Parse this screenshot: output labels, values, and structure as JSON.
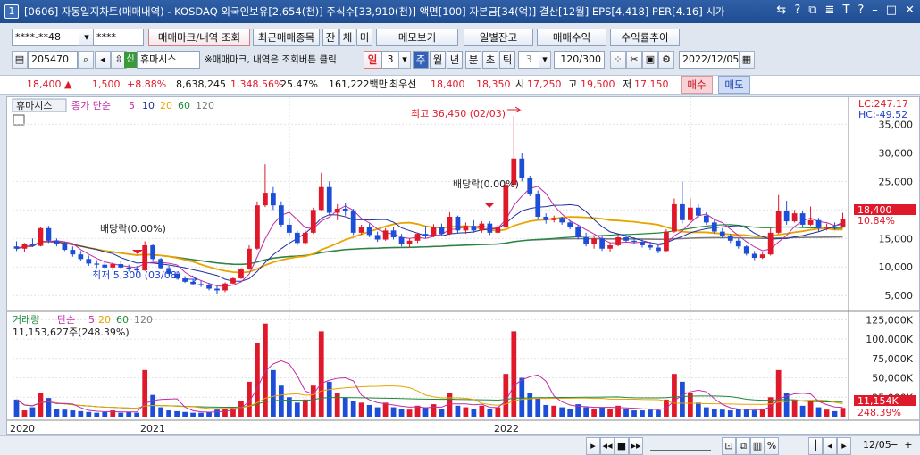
{
  "window": {
    "num": "1",
    "title": "[0606] 자동일지차트(매매내역) - KOSDAQ 외국인보유[2,654(천)] 주식수[33,910(천)] 액면[100] 자본금[34(억)] 결산[12월] EPS[4,418] PER[4.16] 시가",
    "buttons": [
      "⇆",
      "?",
      "⧉",
      "≣",
      "T",
      "?",
      "–",
      "□",
      "✕"
    ]
  },
  "toolbar1": {
    "account": "****-**48",
    "password": "****",
    "trade_mark_btn": "매매마크/내역 조회",
    "recent_items_btn": "최근매매종목",
    "tabs": [
      "잔",
      "체",
      "미"
    ],
    "memo_btn": "메모보기",
    "daily_balance_btn": "일별잔고",
    "trade_profit_btn": "매매수익",
    "return_trend_btn": "수익률추이"
  },
  "toolbar2": {
    "code": "205470",
    "badge": "신",
    "name": "휴마시스",
    "hint": "※매매마크, 내역은 조회버튼 클릭",
    "period_label": "일",
    "period_value": "3",
    "periods": [
      "주",
      "월",
      "년",
      "분",
      "초",
      "틱"
    ],
    "tick_value": "3",
    "count": "120/300",
    "date": "2022/12/05"
  },
  "quote": {
    "price": "18,400",
    "arrow": "▲",
    "change": "1,500",
    "rate": "+8.88%",
    "volume": "8,638,245",
    "vol_rate": "1,348.56%",
    "turnover": "25.47%",
    "amount": "161,222백만",
    "best_label": "최우선",
    "ask": "18,400",
    "bid": "18,350",
    "open_label": "시",
    "open": "17,250",
    "high_label": "고",
    "high": "19,500",
    "low_label": "저",
    "low": "17,150",
    "buy_btn": "매수",
    "sell_btn": "매도"
  },
  "price_panel": {
    "legend": {
      "name": "휴마시스",
      "ma_label": "종가 단순",
      "p5": "5",
      "p10": "10",
      "p20": "20",
      "p60": "60",
      "p120": "120"
    },
    "lc": "LC:247.17",
    "hc": "HC:-49.52",
    "yticks": [
      "35,000",
      "30,000",
      "25,000",
      "20,000",
      "15,000",
      "10,000",
      "5,000"
    ],
    "price_tag": "18,400",
    "pct_tag": "10.84%",
    "annotations": {
      "high": "최고 36,450 (02/03)",
      "low": "최저 5,300 (03/08)",
      "div1": "배당락(0.00%)",
      "div2": "배당락(0.00%)"
    }
  },
  "volume_panel": {
    "legend": {
      "name": "거래량",
      "ma_label": "단순",
      "p5": "5",
      "p20": "20",
      "p60": "60",
      "p120": "120"
    },
    "info": "11,153,627주(248.39%)",
    "yticks": [
      "125,000K",
      "100,000K",
      "75,000K",
      "50,000K",
      "25,000K"
    ],
    "vol_tag": "11,154K",
    "pct_tag": "248.39%"
  },
  "xaxis": {
    "labels": [
      "2020",
      "2021",
      "2022"
    ],
    "end_label": "12/05"
  },
  "colors": {
    "up": "#e0192a",
    "down": "#1d4ed8",
    "ma5": "#c02ca6",
    "ma10": "#1f2f9c",
    "ma20": "#e8a400",
    "ma60": "#1f8a3a",
    "ma120": "#7a7a7a"
  },
  "chart_data": {
    "type": "candlestick",
    "series": [
      {
        "o": 13600,
        "h": 14500,
        "l": 12800,
        "c": 13200
      },
      {
        "o": 13200,
        "h": 14200,
        "l": 12600,
        "c": 14000
      },
      {
        "o": 14000,
        "h": 15000,
        "l": 13500,
        "c": 13700
      },
      {
        "o": 13700,
        "h": 17000,
        "l": 13600,
        "c": 16800
      },
      {
        "o": 16800,
        "h": 17200,
        "l": 14200,
        "c": 14600
      },
      {
        "o": 14600,
        "h": 15000,
        "l": 13600,
        "c": 14000
      },
      {
        "o": 14000,
        "h": 14400,
        "l": 12800,
        "c": 13000
      },
      {
        "o": 13000,
        "h": 13600,
        "l": 11800,
        "c": 12200
      },
      {
        "o": 12200,
        "h": 12800,
        "l": 11000,
        "c": 11400
      },
      {
        "o": 11400,
        "h": 12000,
        "l": 10200,
        "c": 10600
      },
      {
        "o": 10600,
        "h": 11200,
        "l": 9800,
        "c": 10400
      },
      {
        "o": 10400,
        "h": 11000,
        "l": 9600,
        "c": 9900
      },
      {
        "o": 9900,
        "h": 10800,
        "l": 9400,
        "c": 10500
      },
      {
        "o": 10500,
        "h": 11000,
        "l": 9700,
        "c": 9900
      },
      {
        "o": 9900,
        "h": 10400,
        "l": 9200,
        "c": 9600
      },
      {
        "o": 9600,
        "h": 10200,
        "l": 9000,
        "c": 9400
      },
      {
        "o": 9400,
        "h": 14500,
        "l": 9300,
        "c": 13800
      },
      {
        "o": 13800,
        "h": 14000,
        "l": 11000,
        "c": 11400
      },
      {
        "o": 11400,
        "h": 11600,
        "l": 9600,
        "c": 9800
      },
      {
        "o": 9800,
        "h": 10200,
        "l": 8600,
        "c": 8800
      },
      {
        "o": 8800,
        "h": 9200,
        "l": 7800,
        "c": 8000
      },
      {
        "o": 8000,
        "h": 8400,
        "l": 7200,
        "c": 7400
      },
      {
        "o": 7400,
        "h": 7800,
        "l": 6800,
        "c": 7000
      },
      {
        "o": 7000,
        "h": 7600,
        "l": 6500,
        "c": 6900
      },
      {
        "o": 6900,
        "h": 7200,
        "l": 5900,
        "c": 6200
      },
      {
        "o": 6200,
        "h": 6600,
        "l": 5300,
        "c": 5900
      },
      {
        "o": 5900,
        "h": 7300,
        "l": 5600,
        "c": 7100
      },
      {
        "o": 7100,
        "h": 8200,
        "l": 7000,
        "c": 8000
      },
      {
        "o": 8000,
        "h": 9800,
        "l": 7900,
        "c": 9600
      },
      {
        "o": 9600,
        "h": 13800,
        "l": 9500,
        "c": 13200
      },
      {
        "o": 13200,
        "h": 21500,
        "l": 13000,
        "c": 20800
      },
      {
        "o": 20800,
        "h": 28000,
        "l": 20500,
        "c": 23000
      },
      {
        "o": 23000,
        "h": 24000,
        "l": 20000,
        "c": 20800
      },
      {
        "o": 20800,
        "h": 21500,
        "l": 17000,
        "c": 17400
      },
      {
        "o": 17400,
        "h": 18600,
        "l": 15500,
        "c": 16000
      },
      {
        "o": 16000,
        "h": 16400,
        "l": 13800,
        "c": 14200
      },
      {
        "o": 14200,
        "h": 16500,
        "l": 13800,
        "c": 16000
      },
      {
        "o": 16000,
        "h": 20400,
        "l": 15800,
        "c": 20000
      },
      {
        "o": 20000,
        "h": 26500,
        "l": 19800,
        "c": 24000
      },
      {
        "o": 24000,
        "h": 25000,
        "l": 19000,
        "c": 19500
      },
      {
        "o": 19500,
        "h": 21000,
        "l": 18200,
        "c": 20200
      },
      {
        "o": 20200,
        "h": 21200,
        "l": 19000,
        "c": 19800
      },
      {
        "o": 19800,
        "h": 20200,
        "l": 15600,
        "c": 16000
      },
      {
        "o": 16000,
        "h": 17400,
        "l": 15600,
        "c": 17000
      },
      {
        "o": 17000,
        "h": 17600,
        "l": 15200,
        "c": 15600
      },
      {
        "o": 15600,
        "h": 16200,
        "l": 14400,
        "c": 14800
      },
      {
        "o": 14800,
        "h": 16800,
        "l": 14600,
        "c": 16400
      },
      {
        "o": 16400,
        "h": 17000,
        "l": 14800,
        "c": 15200
      },
      {
        "o": 15200,
        "h": 15800,
        "l": 13600,
        "c": 14000
      },
      {
        "o": 14000,
        "h": 15000,
        "l": 13400,
        "c": 14600
      },
      {
        "o": 14600,
        "h": 16000,
        "l": 14200,
        "c": 15800
      },
      {
        "o": 15800,
        "h": 17200,
        "l": 15000,
        "c": 15400
      },
      {
        "o": 15400,
        "h": 17500,
        "l": 15200,
        "c": 17000
      },
      {
        "o": 17000,
        "h": 17600,
        "l": 15400,
        "c": 15800
      },
      {
        "o": 15800,
        "h": 19600,
        "l": 15600,
        "c": 18800
      },
      {
        "o": 18800,
        "h": 19000,
        "l": 16000,
        "c": 16400
      },
      {
        "o": 16400,
        "h": 17800,
        "l": 15800,
        "c": 17200
      },
      {
        "o": 17200,
        "h": 18200,
        "l": 16000,
        "c": 16400
      },
      {
        "o": 16400,
        "h": 18000,
        "l": 16000,
        "c": 17600
      },
      {
        "o": 17600,
        "h": 18000,
        "l": 15600,
        "c": 16000
      },
      {
        "o": 16000,
        "h": 17400,
        "l": 15800,
        "c": 17000
      },
      {
        "o": 17000,
        "h": 25000,
        "l": 16800,
        "c": 24400
      },
      {
        "o": 24400,
        "h": 36450,
        "l": 24000,
        "c": 29000
      },
      {
        "o": 29000,
        "h": 30000,
        "l": 25000,
        "c": 25600
      },
      {
        "o": 25600,
        "h": 26000,
        "l": 22400,
        "c": 22800
      },
      {
        "o": 22800,
        "h": 23400,
        "l": 18400,
        "c": 18800
      },
      {
        "o": 18800,
        "h": 19400,
        "l": 17600,
        "c": 18200
      },
      {
        "o": 18200,
        "h": 19000,
        "l": 17800,
        "c": 18600
      },
      {
        "o": 18600,
        "h": 18800,
        "l": 17400,
        "c": 17800
      },
      {
        "o": 17800,
        "h": 18200,
        "l": 16600,
        "c": 17000
      },
      {
        "o": 17000,
        "h": 17400,
        "l": 14800,
        "c": 15200
      },
      {
        "o": 15200,
        "h": 16000,
        "l": 13600,
        "c": 14000
      },
      {
        "o": 14000,
        "h": 15400,
        "l": 13200,
        "c": 15000
      },
      {
        "o": 15000,
        "h": 15400,
        "l": 12800,
        "c": 13200
      },
      {
        "o": 13200,
        "h": 14200,
        "l": 12600,
        "c": 13800
      },
      {
        "o": 13800,
        "h": 15600,
        "l": 13600,
        "c": 15200
      },
      {
        "o": 15200,
        "h": 15600,
        "l": 14400,
        "c": 14600
      },
      {
        "o": 14600,
        "h": 15200,
        "l": 14000,
        "c": 14400
      },
      {
        "o": 14400,
        "h": 14800,
        "l": 13400,
        "c": 13800
      },
      {
        "o": 13800,
        "h": 14400,
        "l": 13000,
        "c": 13400
      },
      {
        "o": 13400,
        "h": 14000,
        "l": 12400,
        "c": 12800
      },
      {
        "o": 12800,
        "h": 16600,
        "l": 12700,
        "c": 16200
      },
      {
        "o": 16200,
        "h": 22000,
        "l": 16000,
        "c": 21000
      },
      {
        "o": 21000,
        "h": 25000,
        "l": 17600,
        "c": 18200
      },
      {
        "o": 18200,
        "h": 22000,
        "l": 18000,
        "c": 20400
      },
      {
        "o": 20400,
        "h": 21000,
        "l": 18600,
        "c": 19000
      },
      {
        "o": 19000,
        "h": 19600,
        "l": 17400,
        "c": 17800
      },
      {
        "o": 17800,
        "h": 18400,
        "l": 15800,
        "c": 16200
      },
      {
        "o": 16200,
        "h": 16800,
        "l": 15000,
        "c": 15400
      },
      {
        "o": 15400,
        "h": 15800,
        "l": 14200,
        "c": 14600
      },
      {
        "o": 14600,
        "h": 15000,
        "l": 13200,
        "c": 13600
      },
      {
        "o": 13600,
        "h": 13800,
        "l": 12000,
        "c": 12300
      },
      {
        "o": 12300,
        "h": 12800,
        "l": 11200,
        "c": 11600
      },
      {
        "o": 11600,
        "h": 12600,
        "l": 11400,
        "c": 12200
      },
      {
        "o": 12200,
        "h": 16800,
        "l": 12000,
        "c": 16000
      },
      {
        "o": 16000,
        "h": 22600,
        "l": 15800,
        "c": 19800
      },
      {
        "o": 19800,
        "h": 21600,
        "l": 17400,
        "c": 18000
      },
      {
        "o": 18000,
        "h": 20000,
        "l": 17800,
        "c": 19400
      },
      {
        "o": 19400,
        "h": 19800,
        "l": 17000,
        "c": 17400
      },
      {
        "o": 17400,
        "h": 20600,
        "l": 17200,
        "c": 18200
      },
      {
        "o": 18200,
        "h": 18600,
        "l": 16200,
        "c": 16800
      },
      {
        "o": 16800,
        "h": 17600,
        "l": 16400,
        "c": 17000
      },
      {
        "o": 17000,
        "h": 17800,
        "l": 16500,
        "c": 16900
      },
      {
        "o": 16900,
        "h": 19500,
        "l": 17150,
        "c": 18400
      }
    ],
    "volume_K": [
      22000,
      8000,
      12000,
      30000,
      24000,
      10000,
      9000,
      8000,
      7000,
      6000,
      5000,
      6000,
      8000,
      5000,
      6000,
      5000,
      60000,
      28000,
      12000,
      8000,
      7000,
      6000,
      5000,
      5000,
      6000,
      9000,
      10000,
      12000,
      20000,
      45000,
      95000,
      120000,
      60000,
      40000,
      25000,
      18000,
      22000,
      40000,
      110000,
      45000,
      30000,
      25000,
      20000,
      18000,
      15000,
      12000,
      18000,
      12000,
      10000,
      9000,
      14000,
      12000,
      16000,
      10000,
      30000,
      14000,
      12000,
      10000,
      14000,
      10000,
      12000,
      55000,
      110000,
      50000,
      30000,
      24000,
      15000,
      14000,
      12000,
      10000,
      16000,
      12000,
      10000,
      12000,
      10000,
      14000,
      10000,
      8000,
      8000,
      9000,
      8000,
      22000,
      55000,
      45000,
      30000,
      18000,
      12000,
      10000,
      9000,
      8000,
      10000,
      9000,
      8000,
      10000,
      25000,
      60000,
      30000,
      22000,
      14000,
      20000,
      12000,
      9000,
      7000,
      11154
    ]
  }
}
